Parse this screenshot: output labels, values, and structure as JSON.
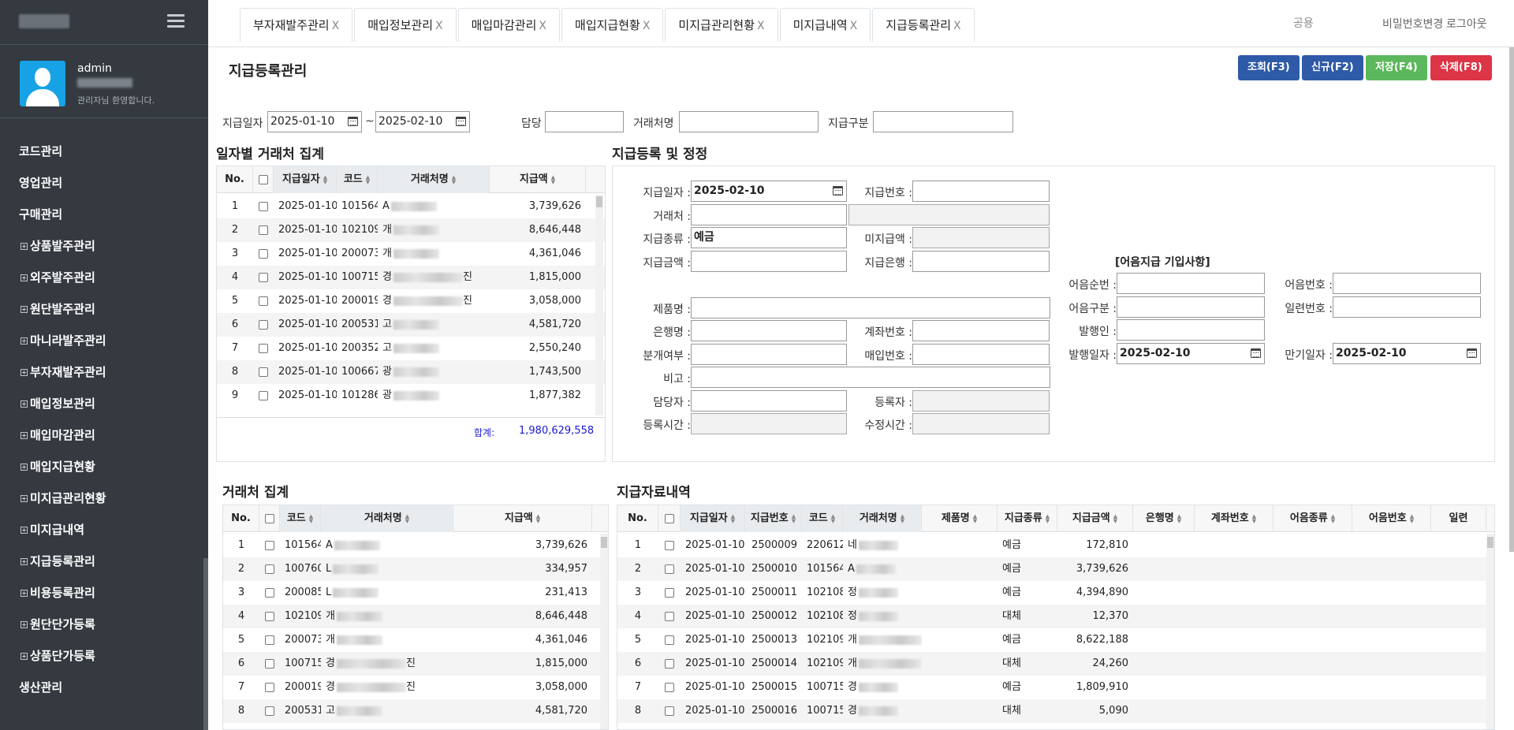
{
  "sidebar": {
    "user": {
      "name": "admin",
      "welcome": "관리자님 환영합니다."
    },
    "menu": [
      {
        "label": "코드관리",
        "sub": false
      },
      {
        "label": "영업관리",
        "sub": false
      },
      {
        "label": "구매관리",
        "sub": false
      },
      {
        "label": "상품발주관리",
        "sub": true
      },
      {
        "label": "외주발주관리",
        "sub": true
      },
      {
        "label": "원단발주관리",
        "sub": true
      },
      {
        "label": "마니라발주관리",
        "sub": true
      },
      {
        "label": "부자재발주관리",
        "sub": true
      },
      {
        "label": "매입정보관리",
        "sub": true
      },
      {
        "label": "매입마감관리",
        "sub": true
      },
      {
        "label": "매입지급현황",
        "sub": true
      },
      {
        "label": "미지급관리현황",
        "sub": true
      },
      {
        "label": "미지급내역",
        "sub": true
      },
      {
        "label": "지급등록관리",
        "sub": true
      },
      {
        "label": "비용등록관리",
        "sub": true
      },
      {
        "label": "원단단가등록",
        "sub": true
      },
      {
        "label": "상품단가등록",
        "sub": true
      },
      {
        "label": "생산관리",
        "sub": false
      }
    ]
  },
  "tabs": [
    "부자재발주관리",
    "매입정보관리",
    "매입마감관리",
    "매입지급현황",
    "미지급관리현황",
    "미지급내역",
    "지급등록관리"
  ],
  "tab_close": "X",
  "topright": {
    "search_placeholder": "공용",
    "change_password": "비밀번호변경",
    "logout": "로그아웃"
  },
  "page": {
    "title": "지급등록관리"
  },
  "buttons": {
    "search": "조회(F3)",
    "new": "신규(F2)",
    "save": "저장(F4)",
    "delete": "삭제(F8)"
  },
  "filters": {
    "date_label": "지급일자",
    "date_from": "2025-01-10",
    "tilde": "~",
    "date_to": "2025-02-10",
    "manager_label": "담당",
    "client_label": "거래처명",
    "type_label": "지급구분"
  },
  "daily": {
    "title": "일자별 거래처 집계",
    "headers": [
      "No.",
      "",
      "지급일자",
      "코드",
      "거래처명",
      "지급액"
    ],
    "rows": [
      {
        "no": "1",
        "date": "2025-01-10",
        "code": "101564",
        "name": "A",
        "amount": "3,739,626"
      },
      {
        "no": "2",
        "date": "2025-01-10",
        "code": "102109",
        "name": "개",
        "amount": "8,646,448"
      },
      {
        "no": "3",
        "date": "2025-01-10",
        "code": "200073",
        "name": "개",
        "amount": "4,361,046"
      },
      {
        "no": "4",
        "date": "2025-01-10",
        "code": "100715",
        "name": "경",
        "amount": "1,815,000",
        "suffix": "진"
      },
      {
        "no": "5",
        "date": "2025-01-10",
        "code": "200019",
        "name": "경",
        "amount": "3,058,000",
        "suffix": "진"
      },
      {
        "no": "6",
        "date": "2025-01-10",
        "code": "200531",
        "name": "고",
        "amount": "4,581,720"
      },
      {
        "no": "7",
        "date": "2025-01-10",
        "code": "200352",
        "name": "고",
        "amount": "2,550,240"
      },
      {
        "no": "8",
        "date": "2025-01-10",
        "code": "100667",
        "name": "광",
        "amount": "1,743,500"
      },
      {
        "no": "9",
        "date": "2025-01-10",
        "code": "101286",
        "name": "광",
        "amount": "1,877,382"
      }
    ],
    "sum_label": "합계:",
    "sum_value": "1,980,629,558"
  },
  "form": {
    "title": "지급등록 및 정정",
    "labels": {
      "pay_date": "지급일자 :",
      "pay_no": "지급번호 :",
      "client": "거래처 :",
      "pay_type": "지급종류 :",
      "unpaid": "미지급액 :",
      "pay_amount": "지급금액 :",
      "pay_bank": "지급은행 :",
      "product": "제품명 :",
      "bank_name": "은행명 :",
      "account_no": "계좌번호 :",
      "split": "분개여부 :",
      "purchase_no": "매입번호 :",
      "note": "비고 :",
      "manager": "담당자 :",
      "registrant": "등록자 :",
      "reg_time": "등록시간 :",
      "mod_time": "수정시간 :"
    },
    "values": {
      "pay_date": "2025-02-10",
      "pay_type": "예금"
    },
    "bill": {
      "title": "[어음지급 기입사항]",
      "labels": {
        "seq": "어음순번 :",
        "no": "어음번호 :",
        "kind": "어음구분 :",
        "serial": "일련번호 :",
        "issuer": "발행인 :",
        "issue_date": "발행일자 :",
        "due_date": "만기일자 :"
      },
      "values": {
        "issue_date": "2025-02-10",
        "due_date": "2025-02-10"
      }
    }
  },
  "client_sum": {
    "title": "거래처 집계",
    "headers": [
      "No.",
      "",
      "코드",
      "거래처명",
      "지급액"
    ],
    "rows": [
      {
        "no": "1",
        "code": "101564",
        "name": "A",
        "amount": "3,739,626"
      },
      {
        "no": "2",
        "code": "100760",
        "name": "L",
        "amount": "334,957"
      },
      {
        "no": "3",
        "code": "200085",
        "name": "L",
        "amount": "231,413"
      },
      {
        "no": "4",
        "code": "102109",
        "name": "개",
        "amount": "8,646,448"
      },
      {
        "no": "5",
        "code": "200073",
        "name": "개",
        "amount": "4,361,046"
      },
      {
        "no": "6",
        "code": "100715",
        "name": "경",
        "amount": "1,815,000",
        "suffix": "진"
      },
      {
        "no": "7",
        "code": "200019",
        "name": "경",
        "amount": "3,058,000",
        "suffix": "진"
      },
      {
        "no": "8",
        "code": "200531",
        "name": "고",
        "amount": "4,581,720"
      }
    ]
  },
  "detail": {
    "title": "지급자료내역",
    "headers": [
      "No.",
      "",
      "지급일자",
      "지급번호",
      "코드",
      "거래처명",
      "제품명",
      "지급종류",
      "지급금액",
      "은행명",
      "계좌번호",
      "어음종류",
      "어음번호",
      "일련"
    ],
    "rows": [
      {
        "no": "1",
        "date": "2025-01-10",
        "pno": "2500009",
        "code": "220612",
        "name": "네",
        "kind": "예금",
        "amount": "172,810"
      },
      {
        "no": "2",
        "date": "2025-01-10",
        "pno": "2500010",
        "code": "101564",
        "name": "A",
        "kind": "예금",
        "amount": "3,739,626"
      },
      {
        "no": "3",
        "date": "2025-01-10",
        "pno": "2500011",
        "code": "102108",
        "name": "정",
        "kind": "예금",
        "amount": "4,394,890"
      },
      {
        "no": "4",
        "date": "2025-01-10",
        "pno": "2500012",
        "code": "102108",
        "name": "정",
        "kind": "대체",
        "amount": "12,370"
      },
      {
        "no": "5",
        "date": "2025-01-10",
        "pno": "2500013",
        "code": "102109",
        "name": "개",
        "kind": "예금",
        "amount": "8,622,188",
        "suffix": "감"
      },
      {
        "no": "6",
        "date": "2025-01-10",
        "pno": "2500014",
        "code": "102109",
        "name": "개",
        "kind": "대체",
        "amount": "24,260",
        "suffix": "감"
      },
      {
        "no": "7",
        "date": "2025-01-10",
        "pno": "2500015",
        "code": "100715",
        "name": "경",
        "kind": "예금",
        "amount": "1,809,910"
      },
      {
        "no": "8",
        "date": "2025-01-10",
        "pno": "2500016",
        "code": "100715",
        "name": "경",
        "kind": "대체",
        "amount": "5,090"
      }
    ]
  }
}
